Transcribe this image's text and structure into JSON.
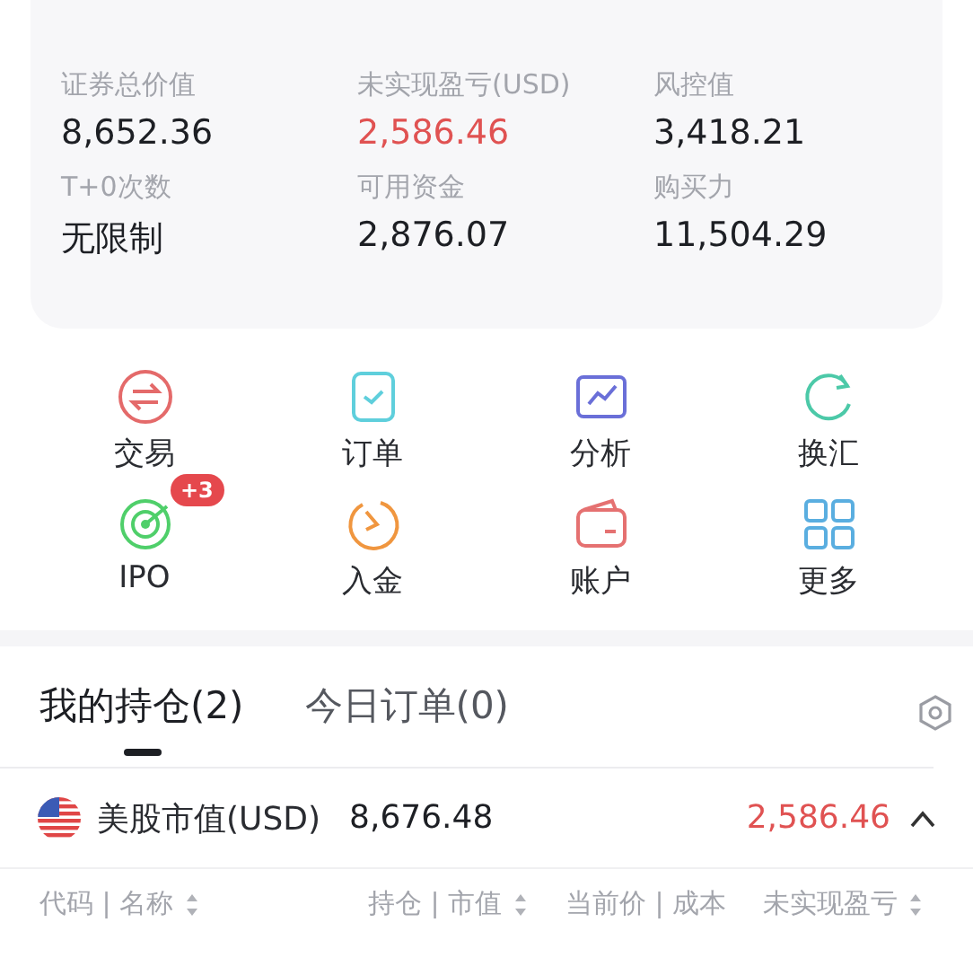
{
  "summary": {
    "stats": [
      {
        "label": "证券总价值",
        "value": "8,652.36",
        "kind": "plain"
      },
      {
        "label": "未实现盈亏(USD)",
        "value": "2,586.46",
        "kind": "gain"
      },
      {
        "label": "风控值",
        "value": "3,418.21",
        "kind": "plain"
      },
      {
        "label": "T+0次数",
        "value": "无限制",
        "kind": "plain"
      },
      {
        "label": "可用资金",
        "value": "2,876.07",
        "kind": "plain"
      },
      {
        "label": "购买力",
        "value": "11,504.29",
        "kind": "plain"
      }
    ]
  },
  "shortcuts": [
    {
      "kind": "trade",
      "label": "交易"
    },
    {
      "kind": "orders",
      "label": "订单"
    },
    {
      "kind": "analysis",
      "label": "分析"
    },
    {
      "kind": "exchange",
      "label": "换汇"
    },
    {
      "kind": "ipo",
      "label": "IPO",
      "badge": "+3"
    },
    {
      "kind": "deposit",
      "label": "入金"
    },
    {
      "kind": "account",
      "label": "账户"
    },
    {
      "kind": "more",
      "label": "更多"
    }
  ],
  "tabs": [
    {
      "label": "我的持仓(2)",
      "selected": true
    },
    {
      "label": "今日订单(0)",
      "selected": false
    }
  ],
  "market": {
    "label": "美股市值(USD)",
    "value": "8,676.48",
    "pnl": "2,586.46",
    "expanded": true
  },
  "columns": [
    {
      "label": "代码 | 名称",
      "sortable": true
    },
    {
      "label": "持仓 | 市值",
      "sortable": true
    },
    {
      "label": "当前价 | 成本",
      "sortable": false
    },
    {
      "label": "未实现盈亏",
      "sortable": true
    }
  ]
}
